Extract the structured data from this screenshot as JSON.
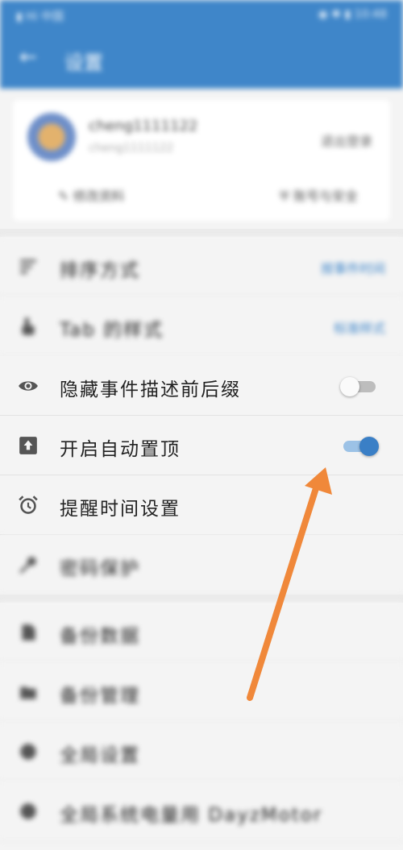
{
  "status_bar": {
    "left": "▮ Hi 中国",
    "right": "◉ ✱ ▮ 10:48"
  },
  "toolbar": {
    "title": "设置"
  },
  "profile": {
    "username": "cheng1111122",
    "user_id": "cheng1111122",
    "logout_label": "退出登录",
    "edit_profile_label": "修改资料",
    "account_security_label": "账号与安全"
  },
  "settings": {
    "row1": {
      "label": "排序方式",
      "value": "按事件时间"
    },
    "row2": {
      "label": "Tab 的样式",
      "value": "标准样式"
    },
    "row3": {
      "label": "隐藏事件描述前后缀",
      "toggle": "off"
    },
    "row4": {
      "label": "开启自动置顶",
      "toggle": "on"
    },
    "row5": {
      "label": "提醒时间设置"
    },
    "row6": {
      "label": "密码保护"
    },
    "row7": {
      "label": "备份数据"
    },
    "row8": {
      "label": "备份管理"
    },
    "row9": {
      "label": "全局设置"
    },
    "row10": {
      "label": "全局系统电量用 DayzMotor"
    }
  },
  "colors": {
    "primary": "#3f86c9",
    "annotation_arrow": "#f0883a"
  }
}
